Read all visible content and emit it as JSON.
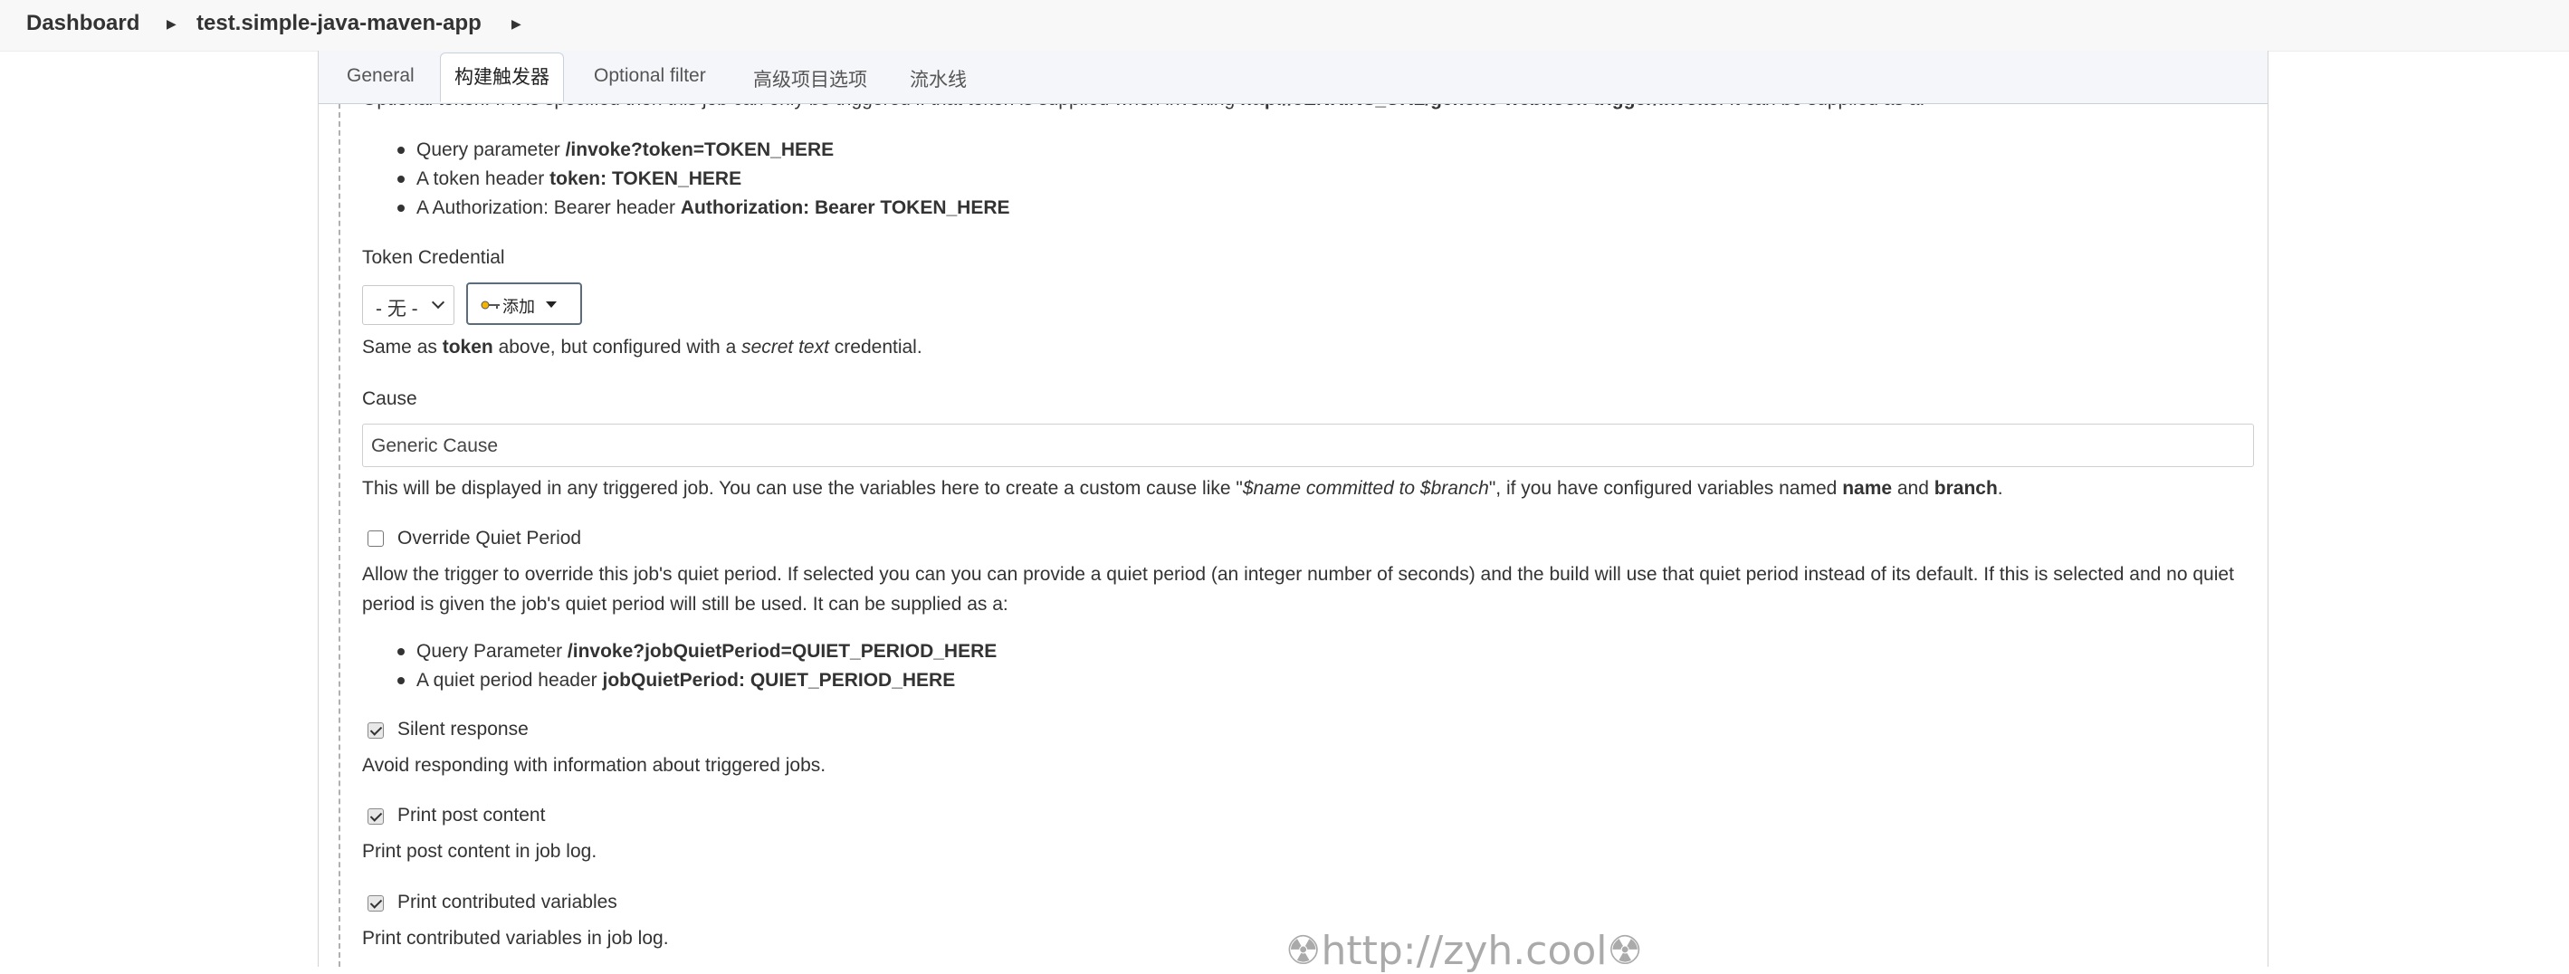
{
  "breadcrumb": {
    "dashboard": "Dashboard",
    "project": "test.simple-java-maven-app",
    "separator_icon": "chevron-right-icon"
  },
  "tabs": [
    {
      "label": "General"
    },
    {
      "label": "构建触发器"
    },
    {
      "label": "Optional filter"
    },
    {
      "label": "高级项目选项"
    },
    {
      "label": "流水线"
    }
  ],
  "active_tab": "构建触发器",
  "token": {
    "help_pre": "Optional token. If it is specified then this job can only be triggered if that token is supplied when invoking ",
    "help_url": "http://JENKINS_URL/generic-webhook-trigger/invoke",
    "help_post": ". It can be supplied as a:",
    "bullets": [
      {
        "pre": "Query parameter ",
        "bold": "/invoke?token=TOKEN_HERE"
      },
      {
        "pre": "A token header ",
        "bold": "token: TOKEN_HERE"
      },
      {
        "pre": "A Authorization: Bearer header ",
        "bold": "Authorization: Bearer TOKEN_HERE"
      }
    ]
  },
  "token_credential": {
    "label": "Token Credential",
    "select_value": "- 无 -",
    "add_button": "添加",
    "help_pre": "Same as ",
    "help_bold": "token",
    "help_mid": " above, but configured with a ",
    "help_italic": "secret text",
    "help_post": " credential."
  },
  "cause": {
    "label": "Cause",
    "value": "Generic Cause",
    "help_pre": "This will be displayed in any triggered job. You can use the variables here to create a custom cause like \"",
    "help_italic": "$name committed to $branch",
    "help_mid": "\", if you have configured variables named ",
    "help_bold1": "name",
    "help_and": " and ",
    "help_bold2": "branch",
    "help_end": "."
  },
  "quiet_period": {
    "label": "Override Quiet Period",
    "checked": false,
    "help_line1": "Allow the trigger to override this job's quiet period. If selected you can you can provide a quiet period (an integer number of seconds) and the build will use that quiet period instead of its default. If this is selected and no quiet",
    "help_line2": "period is given the job's quiet period will still be used. It can be supplied as a:",
    "bullets": [
      {
        "pre": "Query Parameter ",
        "bold": "/invoke?jobQuietPeriod=QUIET_PERIOD_HERE"
      },
      {
        "pre": "A quiet period header ",
        "bold": "jobQuietPeriod: QUIET_PERIOD_HERE"
      }
    ]
  },
  "silent_response": {
    "label": "Silent response",
    "checked": true,
    "help": "Avoid responding with information about triggered jobs."
  },
  "print_post": {
    "label": "Print post content",
    "checked": true,
    "help": "Print post content in job log."
  },
  "print_vars": {
    "label": "Print contributed variables",
    "checked": true,
    "help": "Print contributed variables in job log."
  },
  "watermark": "☢http://zyh.cool☢"
}
